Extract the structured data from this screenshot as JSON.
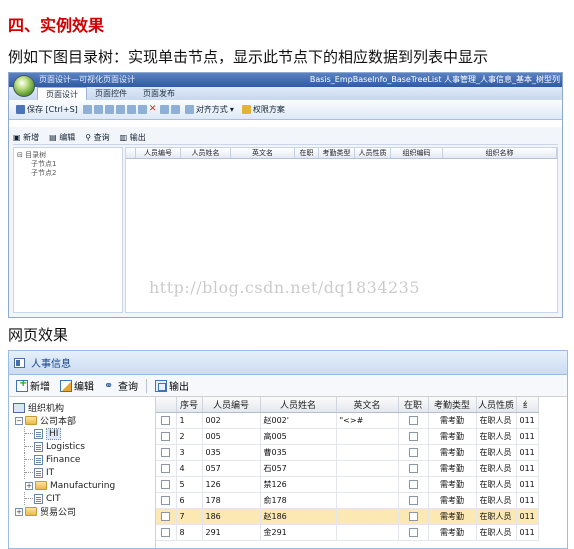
{
  "heading": "四、实例效果",
  "intro": "例如下图目录树：实现单击节点，显示此节点下的相应数据到列表中显示",
  "designer": {
    "title": "页面设计—可视化页面设计",
    "title_right": "Basis_EmpBaseInfo_BaseTreeList  人事管理_人事信息_基本_树型列",
    "tabs": [
      "页面设计",
      "页面控件",
      "页面发布"
    ],
    "ribbon": [
      "保存 [Ctrl+S]",
      "对齐方式",
      "权限方案"
    ],
    "toolbar": [
      "新增",
      "编辑",
      "查询",
      "输出"
    ],
    "tree": {
      "root": "目录树",
      "children": [
        "子节点1",
        "子节点2"
      ]
    },
    "columns": [
      "人员编号",
      "人员姓名",
      "英文名",
      "在职",
      "考勤类型",
      "人员性质",
      "组织编码",
      "组织名称"
    ]
  },
  "watermark": "http://blog.csdn.net/dq1834235",
  "web_label": "网页效果",
  "web": {
    "title": "人事信息",
    "toolbar": {
      "add": "新增",
      "edit": "编辑",
      "query": "查询",
      "export": "输出"
    },
    "tree": {
      "root": "组织机构",
      "company": "公司本部",
      "nodes": [
        "HI",
        "Logistics",
        "Finance",
        "IT",
        "Manufacturing",
        "CIT"
      ],
      "trade": "贸易公司"
    },
    "columns": [
      "序号",
      "人员编号",
      "人员姓名",
      "英文名",
      "在职",
      "考勤类型",
      "人员性质",
      "纟"
    ],
    "rows": [
      {
        "no": "1",
        "code": "002",
        "name": "赵002'",
        "en": "\"<>#",
        "kind": "需考勤",
        "nature": "在职人员",
        "org": "011"
      },
      {
        "no": "2",
        "code": "005",
        "name": "高005",
        "en": "",
        "kind": "需考勤",
        "nature": "在职人员",
        "org": "011"
      },
      {
        "no": "3",
        "code": "035",
        "name": "曹035",
        "en": "",
        "kind": "需考勤",
        "nature": "在职人员",
        "org": "011"
      },
      {
        "no": "4",
        "code": "057",
        "name": "石057",
        "en": "",
        "kind": "需考勤",
        "nature": "在职人员",
        "org": "011"
      },
      {
        "no": "5",
        "code": "126",
        "name": "禁126",
        "en": "",
        "kind": "需考勤",
        "nature": "在职人员",
        "org": "011"
      },
      {
        "no": "6",
        "code": "178",
        "name": "俞178",
        "en": "",
        "kind": "需考勤",
        "nature": "在职人员",
        "org": "011"
      },
      {
        "no": "7",
        "code": "186",
        "name": "赵186",
        "en": "",
        "kind": "需考勤",
        "nature": "在职人员",
        "org": "011"
      },
      {
        "no": "8",
        "code": "291",
        "name": "金291",
        "en": "",
        "kind": "需考勤",
        "nature": "在职人员",
        "org": "011"
      }
    ],
    "highlighted_row": "7"
  }
}
